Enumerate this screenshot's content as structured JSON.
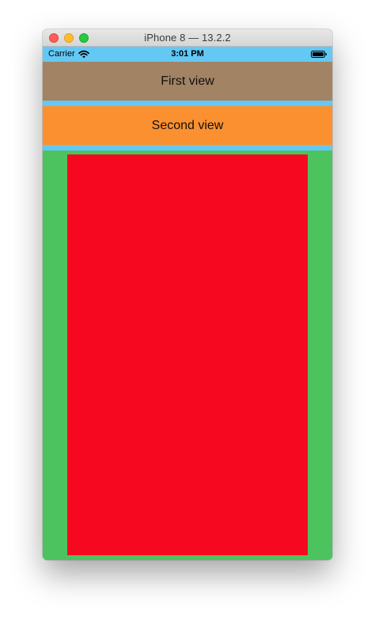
{
  "window": {
    "title": "iPhone 8 — 13.2.2"
  },
  "status_bar": {
    "carrier": "Carrier",
    "time": "3:01 PM"
  },
  "views": {
    "first_label": "First view",
    "second_label": "Second view"
  },
  "colors": {
    "status_bar": "#64c8f5",
    "first_view": "#a28363",
    "second_view": "#fa9030",
    "container": "#4cc35f",
    "red_view": "#f60920"
  },
  "icons": {
    "wifi": "wifi-icon",
    "battery": "battery-icon"
  }
}
